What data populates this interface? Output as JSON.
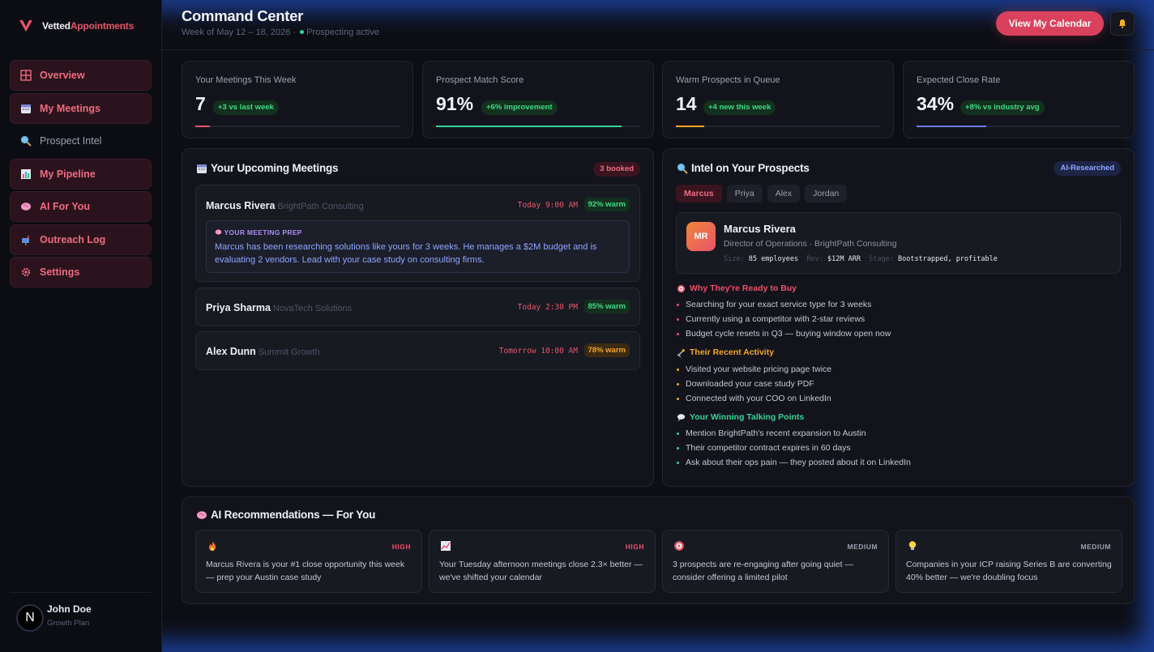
{
  "brand": {
    "name_prefix": "Vetted",
    "name_suffix": "Appointments",
    "accent": "#e8546a"
  },
  "sidebar": {
    "items": [
      {
        "label": "Overview",
        "icon": "grid-icon"
      },
      {
        "label": "My Meetings",
        "icon": "calendar-icon"
      },
      {
        "label": "Prospect Intel",
        "icon": "magnifier-icon"
      },
      {
        "label": "My Pipeline",
        "icon": "bar-chart-icon"
      },
      {
        "label": "AI For You",
        "icon": "brain-icon"
      },
      {
        "label": "Outreach Log",
        "icon": "mailbox-icon"
      },
      {
        "label": "Settings",
        "icon": "gear-icon"
      }
    ]
  },
  "user": {
    "initial": "N",
    "name": "John Doe",
    "plan": "Growth Plan"
  },
  "header": {
    "title": "Command Center",
    "subtitle": "Week of May 12 – 18, 2026 ·",
    "status": "Prospecting active",
    "calendar_button": "View My Calendar",
    "bell_icon": "bell-icon"
  },
  "stats": [
    {
      "label": "Your Meetings This Week",
      "value": "7",
      "badge": "+3 vs last week",
      "progress": 0.07,
      "color": "#e8546a"
    },
    {
      "label": "Prospect Match Score",
      "value": "91%",
      "badge": "+6% improvement",
      "progress": 0.91,
      "color": "#34d399"
    },
    {
      "label": "Warm Prospects in Queue",
      "value": "14",
      "badge": "+4 new this week",
      "progress": 0.14,
      "color": "#f5a524"
    },
    {
      "label": "Expected Close Rate",
      "value": "34%",
      "badge": "+8% vs industry avg",
      "progress": 0.34,
      "color": "#7079e0"
    }
  ],
  "meetings": {
    "title": "Your Upcoming Meetings",
    "count_badge": "3 booked",
    "items": [
      {
        "name": "Marcus Rivera",
        "company": "BrightPath Consulting",
        "time": "Today 9:00 AM",
        "warmth": "92% warm"
      },
      {
        "name": "Priya Sharma",
        "company": "NovaTech Solutions",
        "time": "Today 2:30 PM",
        "warmth": "85% warm"
      },
      {
        "name": "Alex Dunn",
        "company": "Summit Growth",
        "time": "Tomorrow 10:00 AM",
        "warmth": "78% warm"
      }
    ],
    "prep_label": "YOUR MEETING PREP",
    "prep_text": "Marcus has been researching solutions like yours for 3 weeks. He manages a $2M budget and is evaluating 2 vendors. Lead with your case study on consulting firms."
  },
  "intel": {
    "title": "Intel on Your Prospects",
    "badge": "AI-Researched",
    "tabs": [
      "Marcus",
      "Priya",
      "Alex",
      "Jordan"
    ],
    "profile": {
      "initials": "MR",
      "name": "Marcus Rivera",
      "role": "Director of Operations · BrightPath Consulting",
      "size_label": "Size:",
      "size": "85 employees",
      "rev_label": "Rev:",
      "rev": "$12M ARR",
      "stage_label": "Stage:",
      "stage": "Bootstrapped, profitable"
    },
    "sections": [
      {
        "title": "Why They're Ready to Buy",
        "color": "#ef4d6a",
        "icon": "target-icon",
        "items": [
          "Searching for your exact service type for 3 weeks",
          "Currently using a competitor with 2-star reviews",
          "Budget cycle resets in Q3 — buying window open now"
        ]
      },
      {
        "title": "Their Recent Activity",
        "color": "#f5a524",
        "icon": "satellite-icon",
        "items": [
          "Visited your website pricing page twice",
          "Downloaded your case study PDF",
          "Connected with your COO on LinkedIn"
        ]
      },
      {
        "title": "Your Winning Talking Points",
        "color": "#34d399",
        "icon": "speech-bubble-icon",
        "items": [
          "Mention BrightPath's recent expansion to Austin",
          "Their competitor contract expires in 60 days",
          "Ask about their ops pain — they posted about it on LinkedIn"
        ]
      }
    ]
  },
  "recommendations": {
    "title": "AI Recommendations — For You",
    "items": [
      {
        "icon": "fire-icon",
        "level": "HIGH",
        "text": "Marcus Rivera is your #1 close opportunity this week — prep your Austin case study"
      },
      {
        "icon": "trend-chart-icon",
        "level": "HIGH",
        "text": "Your Tuesday afternoon meetings close 2.3× better — we've shifted your calendar"
      },
      {
        "icon": "target-icon",
        "level": "MEDIUM",
        "text": "3 prospects are re-engaging after going quiet — consider offering a limited pilot"
      },
      {
        "icon": "lightbulb-icon",
        "level": "MEDIUM",
        "text": "Companies in your ICP raising Series B are converting 40% better — we're doubling focus"
      }
    ]
  }
}
